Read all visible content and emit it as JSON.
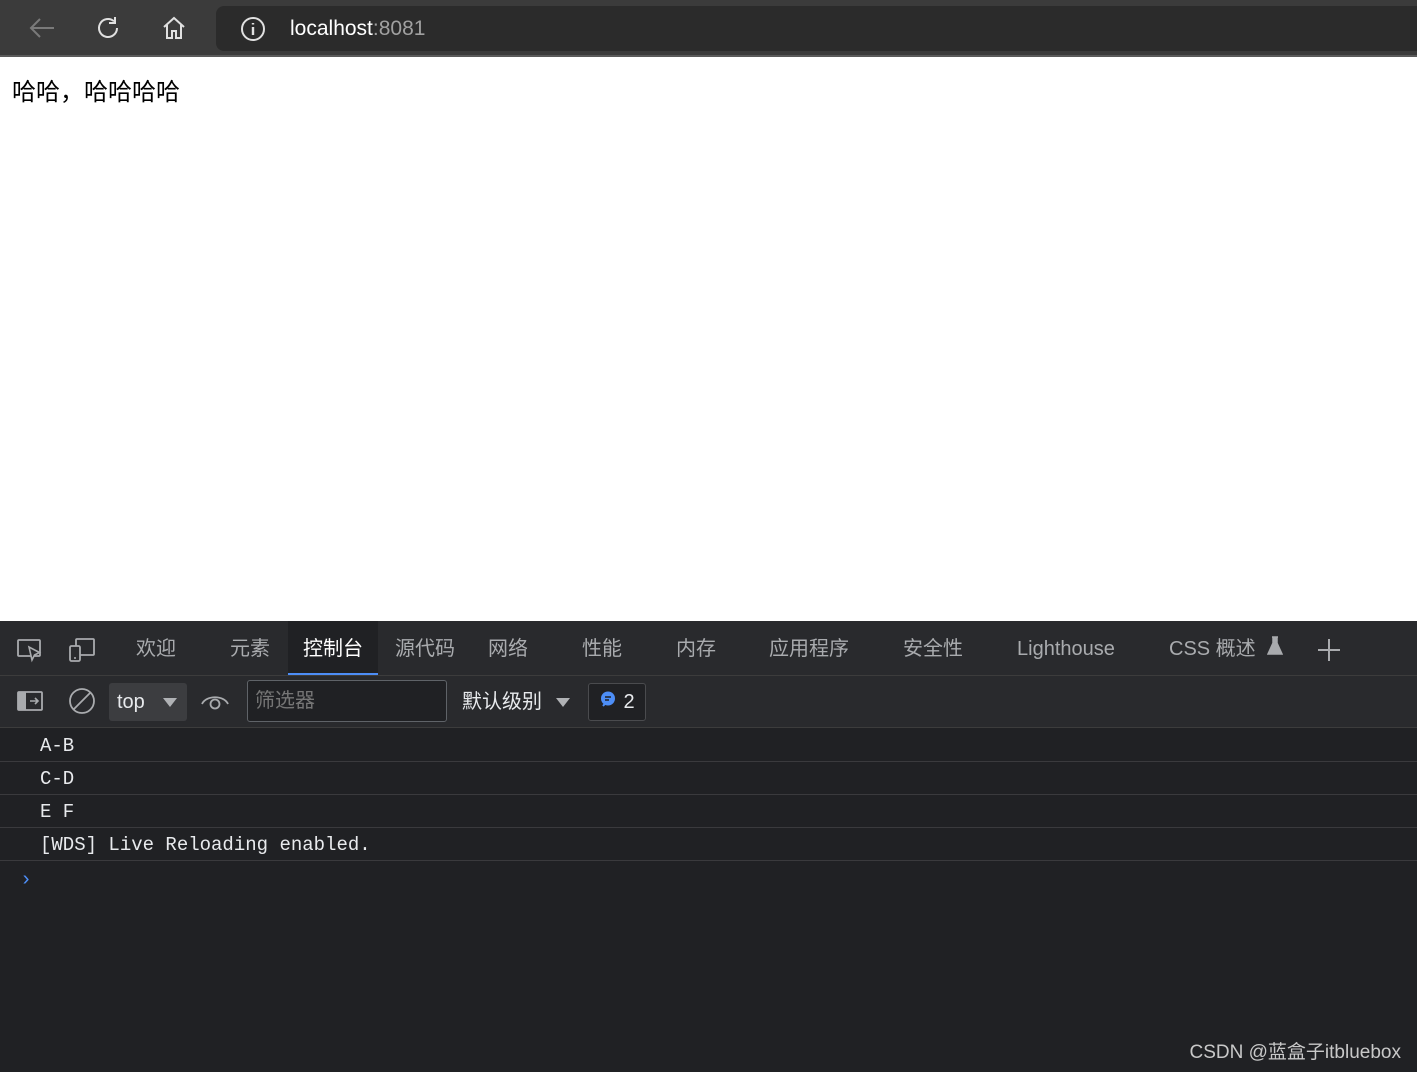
{
  "browser": {
    "url_host": "localhost",
    "url_port": ":8081",
    "icons": [
      "back-icon",
      "refresh-icon",
      "home-icon",
      "info-icon"
    ]
  },
  "page": {
    "text": "哈哈，哈哈哈哈"
  },
  "devtools": {
    "tabs": [
      {
        "label": "欢迎"
      },
      {
        "label": "元素"
      },
      {
        "label": "控制台",
        "active": true
      },
      {
        "label": "源代码"
      },
      {
        "label": "网络"
      },
      {
        "label": "性能"
      },
      {
        "label": "内存"
      },
      {
        "label": "应用程序"
      },
      {
        "label": "安全性"
      },
      {
        "label": "Lighthouse"
      },
      {
        "label": "CSS 概述"
      }
    ],
    "toolbar": {
      "context": "top",
      "filter_placeholder": "筛选器",
      "level": "默认级别",
      "issues_count": "2"
    },
    "console_logs": [
      "A-B",
      "C-D",
      "E F",
      "[WDS] Live Reloading enabled."
    ],
    "prompt": "›"
  },
  "watermark": "CSDN @蓝盒子itbluebox",
  "colors": {
    "toolbar_bg": "#3b3b3b",
    "devtools_bg": "#202124",
    "active_tab_underline": "#4d8ef7"
  }
}
